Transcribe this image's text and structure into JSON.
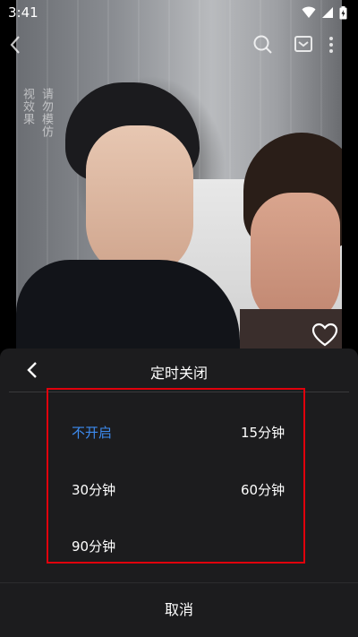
{
  "status_bar": {
    "time": "3:41"
  },
  "watermark": {
    "columns": [
      "视效果",
      "请勿模仿"
    ]
  },
  "timer_sheet": {
    "title": "定时关闭",
    "options": [
      "不开启",
      "15分钟",
      "30分钟",
      "60分钟",
      "90分钟"
    ],
    "selected_option": "不开启",
    "cancel_label": "取消"
  },
  "colors": {
    "accent": "#3d8bf0",
    "sheet_background": "#1c1c1e",
    "highlight_box": "#e0000c"
  },
  "icons": [
    "back-icon",
    "search-icon",
    "cast-icon",
    "more-icon",
    "heart-icon",
    "wifi-icon",
    "signal-icon",
    "battery-icon"
  ]
}
